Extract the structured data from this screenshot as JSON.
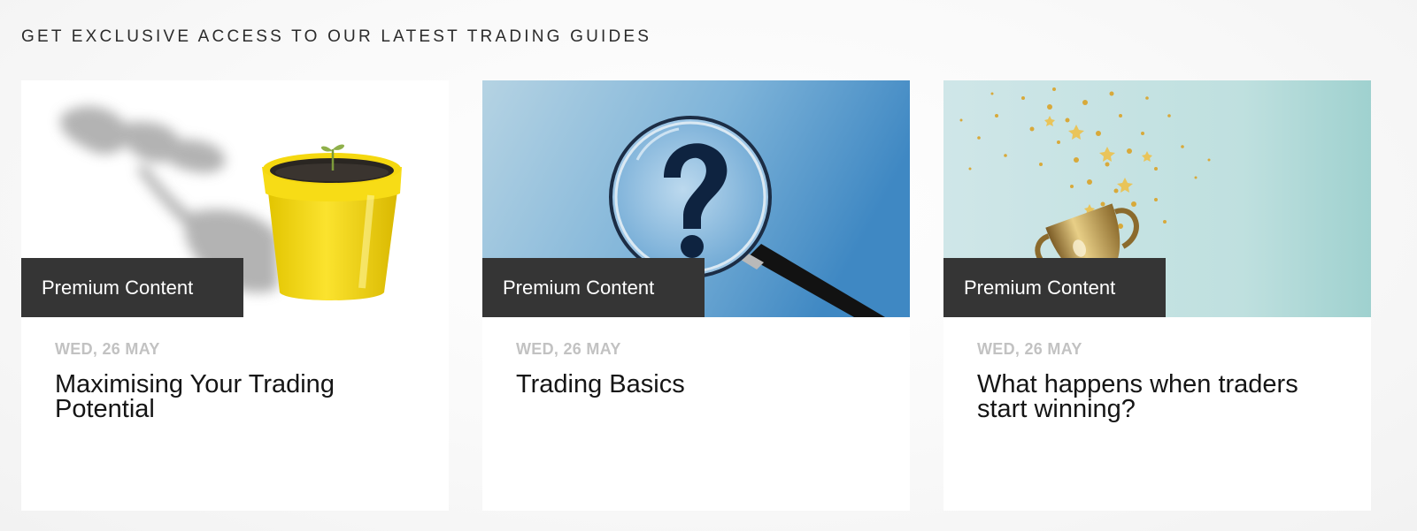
{
  "section": {
    "heading": "GET EXCLUSIVE ACCESS TO OUR LATEST TRADING GUIDES"
  },
  "cards": [
    {
      "image_icon": "plant-pot-image",
      "badge": "Premium Content",
      "date": "WED, 26 MAY",
      "title": "Maximising Your Trading Potential"
    },
    {
      "image_icon": "magnifying-glass-question-image",
      "badge": "Premium Content",
      "date": "WED, 26 MAY",
      "title": "Trading Basics"
    },
    {
      "image_icon": "trophy-confetti-image",
      "badge": "Premium Content",
      "date": "WED, 26 MAY",
      "title": "What happens when traders start winning?"
    }
  ],
  "colors": {
    "badge_bg": "#353535",
    "date_text": "#c2c2c2",
    "title_text": "#151515",
    "pot_yellow": "#f2d51a",
    "blue_bg": "#4a8fc6",
    "teal_bg": "#bfe0df",
    "gold": "#d8a93a"
  }
}
